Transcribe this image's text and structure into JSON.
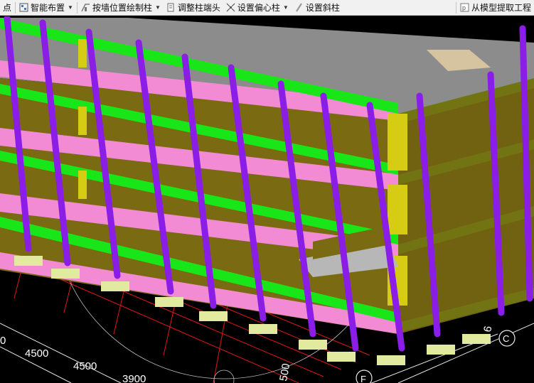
{
  "toolbar": {
    "partial_left": "点",
    "smart_layout": "智能布置",
    "draw_by_wall": "按墙位置绘制柱",
    "adjust_column_end": "调整柱端头",
    "set_eccentric": "设置偏心柱",
    "set_inclined": "设置斜柱",
    "extract_from_model": "从模型提取工程"
  },
  "icons": [
    "smart-layout-icon",
    "wall-column-icon",
    "column-end-icon",
    "eccentric-column-icon",
    "inclined-column-icon",
    "extract-model-icon"
  ],
  "colors": {
    "background": "#000000",
    "column": "#8a1ee6",
    "beam": "#19e619",
    "slab": "#f28ad4",
    "wall": "#7a6a12",
    "wall_window": "#d6cc14",
    "footing": "#e2eaa0",
    "roof": "#8c8c8c",
    "grid_line": "#e01616",
    "axis_line": "#e8e8e8"
  },
  "viewport": {
    "dimension_labels": [
      "4500",
      "4500",
      "3900",
      "500",
      "0",
      "6"
    ],
    "axis_labels": [
      "C",
      "F"
    ]
  }
}
